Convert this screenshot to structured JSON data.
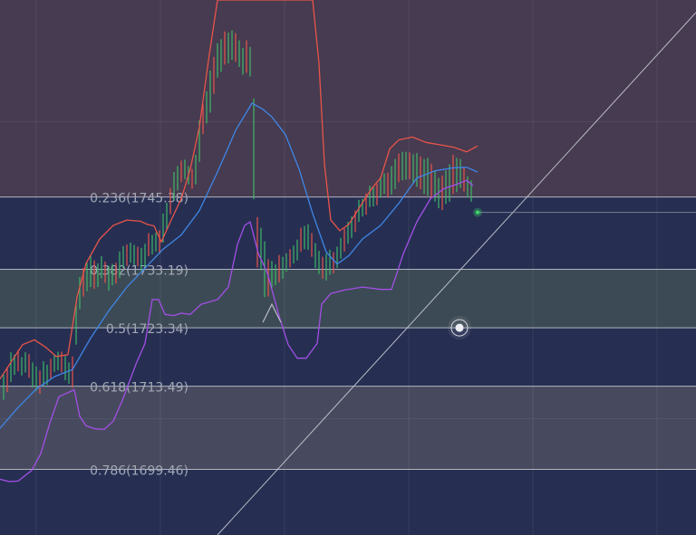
{
  "chart_data": {
    "type": "line",
    "xlabel": "",
    "ylabel": "",
    "grid": true,
    "background": "#283052",
    "y_range": [
      1688.4,
      1778.6
    ],
    "fib_levels": [
      {
        "ratio": "0.236",
        "price": "1745.38",
        "label": "0.236(1745.38)",
        "y": 1745.38,
        "band_color": "#262f52"
      },
      {
        "ratio": "0.382",
        "price": "1733.19",
        "label": "0.382(1733.19)",
        "y": 1733.19,
        "band_color": "#3c4a55"
      },
      {
        "ratio": "0.5",
        "price": "1723.34",
        "label": "0.5(1723.34)",
        "y": 1723.34,
        "band_color": "#262f52"
      },
      {
        "ratio": "0.618",
        "price": "1713.49",
        "label": "0.618(1713.49)",
        "y": 1713.49,
        "band_color": "#474a5e"
      },
      {
        "ratio": "0.786",
        "price": "1699.46",
        "label": "0.786(1699.46)",
        "y": 1699.46,
        "band_color": "#262f52"
      }
    ],
    "top_band_color": "#463b50",
    "colors": {
      "upper_band": "#e8544a",
      "middle_band": "#3f86e6",
      "lower_band": "#a34fe6",
      "candle_up": "#3fb768",
      "candle_down": "#e8544a",
      "fib_line": "#c8cad2",
      "trend_line": "#c9cbd4",
      "price_marker": "#3fd36a"
    },
    "series": [
      {
        "role": "upper",
        "points": [
          [
            0,
            1714.7
          ],
          [
            12,
            1717.5
          ],
          [
            25,
            1720.5
          ],
          [
            38,
            1721.3
          ],
          [
            50,
            1720.1
          ],
          [
            62,
            1718.5
          ],
          [
            75,
            1718.8
          ],
          [
            85,
            1728.5
          ],
          [
            95,
            1734.2
          ],
          [
            110,
            1738.3
          ],
          [
            125,
            1740.6
          ],
          [
            140,
            1741.5
          ],
          [
            155,
            1741.3
          ],
          [
            162,
            1740.8
          ],
          [
            170,
            1740.5
          ],
          [
            178,
            1737.8
          ],
          [
            188,
            1741.2
          ],
          [
            200,
            1745.1
          ],
          [
            210,
            1750.1
          ],
          [
            220,
            1757.2
          ],
          [
            230,
            1768.4
          ],
          [
            240,
            1778.6
          ],
          [
            345,
            1778.6
          ],
          [
            352,
            1767.9
          ],
          [
            358,
            1750.9
          ],
          [
            365,
            1741.5
          ],
          [
            375,
            1739.7
          ],
          [
            385,
            1740.8
          ],
          [
            395,
            1743.2
          ],
          [
            410,
            1746.8
          ],
          [
            420,
            1748.6
          ],
          [
            430,
            1753.5
          ],
          [
            440,
            1755.0
          ],
          [
            455,
            1755.5
          ],
          [
            470,
            1754.6
          ],
          [
            485,
            1754.2
          ],
          [
            500,
            1753.8
          ],
          [
            515,
            1753.0
          ],
          [
            527,
            1754.0
          ]
        ]
      },
      {
        "role": "middle",
        "points": [
          [
            0,
            1706.4
          ],
          [
            20,
            1709.9
          ],
          [
            40,
            1713.0
          ],
          [
            60,
            1715.1
          ],
          [
            80,
            1716.3
          ],
          [
            100,
            1721.6
          ],
          [
            120,
            1726.2
          ],
          [
            140,
            1730.2
          ],
          [
            160,
            1733.4
          ],
          [
            180,
            1736.6
          ],
          [
            200,
            1739.0
          ],
          [
            220,
            1743.1
          ],
          [
            240,
            1749.6
          ],
          [
            260,
            1756.6
          ],
          [
            278,
            1761.2
          ],
          [
            290,
            1760.2
          ],
          [
            300,
            1758.9
          ],
          [
            315,
            1755.9
          ],
          [
            330,
            1750.1
          ],
          [
            345,
            1742.6
          ],
          [
            360,
            1736.1
          ],
          [
            372,
            1734.1
          ],
          [
            385,
            1735.5
          ],
          [
            400,
            1738.3
          ],
          [
            420,
            1740.6
          ],
          [
            440,
            1744.3
          ],
          [
            460,
            1748.6
          ],
          [
            480,
            1749.8
          ],
          [
            500,
            1750.3
          ],
          [
            515,
            1750.4
          ],
          [
            527,
            1749.6
          ]
        ]
      },
      {
        "role": "lower",
        "points": [
          [
            0,
            1697.8
          ],
          [
            10,
            1697.4
          ],
          [
            20,
            1697.5
          ],
          [
            35,
            1699.3
          ],
          [
            45,
            1702.1
          ],
          [
            55,
            1707.3
          ],
          [
            65,
            1711.7
          ],
          [
            75,
            1712.4
          ],
          [
            82,
            1712.9
          ],
          [
            88,
            1708.4
          ],
          [
            95,
            1706.8
          ],
          [
            105,
            1706.3
          ],
          [
            115,
            1706.2
          ],
          [
            125,
            1707.6
          ],
          [
            135,
            1711.1
          ],
          [
            150,
            1717.2
          ],
          [
            160,
            1720.7
          ],
          [
            168,
            1728.1
          ],
          [
            175,
            1728.1
          ],
          [
            182,
            1725.6
          ],
          [
            192,
            1725.4
          ],
          [
            200,
            1725.8
          ],
          [
            210,
            1725.6
          ],
          [
            222,
            1727.3
          ],
          [
            240,
            1728.1
          ],
          [
            252,
            1730.2
          ],
          [
            262,
            1737.4
          ],
          [
            270,
            1740.6
          ],
          [
            276,
            1741.2
          ],
          [
            285,
            1735.9
          ],
          [
            295,
            1732.6
          ],
          [
            308,
            1725.3
          ],
          [
            318,
            1720.5
          ],
          [
            328,
            1718.2
          ],
          [
            338,
            1718.2
          ],
          [
            350,
            1720.7
          ],
          [
            355,
            1727.3
          ],
          [
            365,
            1729.1
          ],
          [
            380,
            1729.7
          ],
          [
            400,
            1730.2
          ],
          [
            420,
            1729.8
          ],
          [
            432,
            1729.8
          ],
          [
            445,
            1735.8
          ],
          [
            460,
            1741.2
          ],
          [
            475,
            1745.1
          ],
          [
            490,
            1746.8
          ],
          [
            505,
            1747.6
          ],
          [
            515,
            1748.2
          ],
          [
            522,
            1747.3
          ]
        ]
      }
    ],
    "candles": [
      [
        4,
        1711.2,
        1715.4
      ],
      [
        8,
        1712.5,
        1716.7
      ],
      [
        12,
        1714.2,
        1719.2
      ],
      [
        16,
        1715.4,
        1718.8
      ],
      [
        20,
        1716.0,
        1719.6
      ],
      [
        24,
        1715.3,
        1718.4
      ],
      [
        28,
        1715.8,
        1719.2
      ],
      [
        32,
        1714.9,
        1718.9
      ],
      [
        36,
        1713.3,
        1717.5
      ],
      [
        40,
        1712.7,
        1716.8
      ],
      [
        44,
        1712.2,
        1716.1
      ],
      [
        48,
        1713.5,
        1717.7
      ],
      [
        52,
        1713.7,
        1717.1
      ],
      [
        56,
        1714.8,
        1718.1
      ],
      [
        60,
        1715.9,
        1718.8
      ],
      [
        64,
        1716.2,
        1719.3
      ],
      [
        68,
        1715.8,
        1719.3
      ],
      [
        72,
        1714.5,
        1718.6
      ],
      [
        76,
        1713.9,
        1717.5
      ],
      [
        80,
        1713.2,
        1718.5
      ],
      [
        84,
        1720.5,
        1727.8
      ],
      [
        88,
        1726.5,
        1731.9
      ],
      [
        92,
        1728.6,
        1733.4
      ],
      [
        96,
        1729.5,
        1734.3
      ],
      [
        100,
        1730.2,
        1735.5
      ],
      [
        104,
        1729.9,
        1734.7
      ],
      [
        108,
        1730.2,
        1734.2
      ],
      [
        112,
        1731.7,
        1735.4
      ],
      [
        116,
        1730.9,
        1734.5
      ],
      [
        120,
        1729.6,
        1733.8
      ],
      [
        124,
        1730.5,
        1734.1
      ],
      [
        128,
        1730.8,
        1734.3
      ],
      [
        132,
        1731.7,
        1736.2
      ],
      [
        136,
        1733.4,
        1737.1
      ],
      [
        140,
        1733.8,
        1737.4
      ],
      [
        144,
        1734.3,
        1737.7
      ],
      [
        148,
        1733.9,
        1737.3
      ],
      [
        152,
        1733.7,
        1737.0
      ],
      [
        156,
        1732.8,
        1736.8
      ],
      [
        160,
        1733.6,
        1737.5
      ],
      [
        164,
        1735.4,
        1739.3
      ],
      [
        168,
        1735.7,
        1739.0
      ],
      [
        172,
        1736.2,
        1739.4
      ],
      [
        176,
        1735.8,
        1739.8
      ],
      [
        180,
        1737.7,
        1742.6
      ],
      [
        184,
        1740.0,
        1744.4
      ],
      [
        188,
        1742.5,
        1746.9
      ],
      [
        192,
        1744.8,
        1749.6
      ],
      [
        196,
        1746.5,
        1750.6
      ],
      [
        200,
        1747.9,
        1751.5
      ],
      [
        204,
        1748.4,
        1751.7
      ],
      [
        208,
        1747.5,
        1750.6
      ],
      [
        212,
        1746.8,
        1750.1
      ],
      [
        216,
        1747.5,
        1752.5
      ],
      [
        220,
        1751.3,
        1758.3
      ],
      [
        224,
        1756.0,
        1761.0
      ],
      [
        228,
        1757.8,
        1763.2
      ],
      [
        232,
        1759.6,
        1766.7
      ],
      [
        236,
        1762.8,
        1769.0
      ],
      [
        240,
        1765.5,
        1771.3
      ],
      [
        244,
        1766.5,
        1772.0
      ],
      [
        248,
        1767.7,
        1773.3
      ],
      [
        252,
        1767.9,
        1773.1
      ],
      [
        256,
        1768.5,
        1773.5
      ],
      [
        260,
        1768.2,
        1773.0
      ],
      [
        264,
        1767.3,
        1771.8
      ],
      [
        268,
        1766.0,
        1770.5
      ],
      [
        272,
        1766.3,
        1771.8
      ],
      [
        276,
        1765.7,
        1770.7
      ],
      [
        280,
        1745.0,
        1762.0
      ],
      [
        284,
        1733.5,
        1742.0
      ],
      [
        288,
        1733.0,
        1740.2
      ],
      [
        292,
        1728.5,
        1737.9
      ],
      [
        296,
        1728.6,
        1734.9
      ],
      [
        300,
        1730.1,
        1734.6
      ],
      [
        304,
        1730.5,
        1734.0
      ],
      [
        308,
        1731.0,
        1735.6
      ],
      [
        312,
        1731.6,
        1735.3
      ],
      [
        316,
        1732.8,
        1735.9
      ],
      [
        320,
        1733.5,
        1736.6
      ],
      [
        324,
        1734.2,
        1737.2
      ],
      [
        328,
        1734.7,
        1738.2
      ],
      [
        332,
        1736.2,
        1740.2
      ],
      [
        336,
        1736.6,
        1740.5
      ],
      [
        340,
        1736.5,
        1740.8
      ],
      [
        344,
        1735.3,
        1739.3
      ],
      [
        348,
        1733.4,
        1737.6
      ],
      [
        352,
        1732.4,
        1736.3
      ],
      [
        356,
        1731.6,
        1735.3
      ],
      [
        360,
        1731.3,
        1735.8
      ],
      [
        364,
        1732.3,
        1736.5
      ],
      [
        368,
        1732.5,
        1736.1
      ],
      [
        372,
        1733.4,
        1737.0
      ],
      [
        376,
        1735.0,
        1738.5
      ],
      [
        380,
        1736.2,
        1740.1
      ],
      [
        384,
        1737.5,
        1741.2
      ],
      [
        388,
        1738.5,
        1742.1
      ],
      [
        392,
        1739.5,
        1743.1
      ],
      [
        396,
        1741.2,
        1744.9
      ],
      [
        400,
        1742.1,
        1745.1
      ],
      [
        404,
        1742.4,
        1746.0
      ],
      [
        408,
        1743.7,
        1747.3
      ],
      [
        412,
        1743.8,
        1747.1
      ],
      [
        416,
        1744.0,
        1747.6
      ],
      [
        420,
        1745.3,
        1748.8
      ],
      [
        424,
        1745.9,
        1749.4
      ],
      [
        428,
        1745.3,
        1749.5
      ],
      [
        432,
        1745.8,
        1750.6
      ],
      [
        436,
        1746.7,
        1751.8
      ],
      [
        440,
        1747.9,
        1752.7
      ],
      [
        444,
        1748.2,
        1753.0
      ],
      [
        448,
        1748.3,
        1753.0
      ],
      [
        452,
        1748.4,
        1752.9
      ],
      [
        456,
        1747.6,
        1752.6
      ],
      [
        460,
        1747.1,
        1752.8
      ],
      [
        464,
        1746.7,
        1752.2
      ],
      [
        468,
        1745.9,
        1751.8
      ],
      [
        472,
        1745.6,
        1752.0
      ],
      [
        476,
        1745.4,
        1751.0
      ],
      [
        480,
        1744.6,
        1749.8
      ],
      [
        484,
        1743.5,
        1748.6
      ],
      [
        488,
        1743.2,
        1749.0
      ],
      [
        492,
        1744.2,
        1749.9
      ],
      [
        496,
        1744.6,
        1750.9
      ],
      [
        500,
        1745.9,
        1752.5
      ],
      [
        504,
        1746.2,
        1752.0
      ],
      [
        508,
        1746.9,
        1751.8
      ],
      [
        512,
        1746.3,
        1750.3
      ],
      [
        516,
        1745.3,
        1748.9
      ],
      [
        520,
        1744.6,
        1748.2
      ]
    ],
    "trend_line": {
      "from": [
        240,
        1688.4
      ],
      "to": [
        768,
        1776.5
      ]
    },
    "trend_anchor": {
      "x": 507,
      "y": 1723.34
    },
    "last_price_marker": {
      "x": 527,
      "y": 1742.8
    },
    "last_price_line": {
      "from": [
        527,
        1742.8
      ],
      "to": [
        768,
        1742.8
      ]
    },
    "peak_annotation": {
      "x": 300,
      "y": 1727.3
    }
  }
}
